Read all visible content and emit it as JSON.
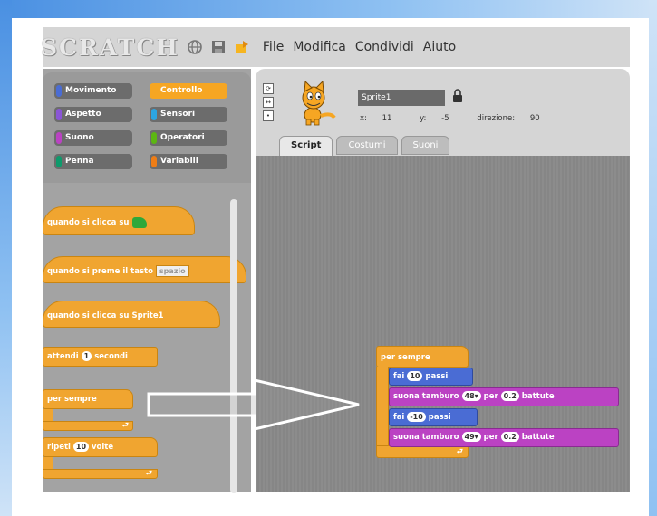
{
  "menubar": {
    "logo": "SCRATCH",
    "menus": [
      "File",
      "Modifica",
      "Condividi",
      "Aiuto"
    ]
  },
  "categories": [
    {
      "label": "Movimento",
      "color": "#4a6cd4"
    },
    {
      "label": "Controllo",
      "color": "#f6a623",
      "active": true
    },
    {
      "label": "Aspetto",
      "color": "#8a55d7"
    },
    {
      "label": "Sensori",
      "color": "#2ca5e2"
    },
    {
      "label": "Suono",
      "color": "#bb42c3"
    },
    {
      "label": "Operatori",
      "color": "#5cb712"
    },
    {
      "label": "Penna",
      "color": "#0e9a6c"
    },
    {
      "label": "Variabili",
      "color": "#ee7d16"
    }
  ],
  "palette_blocks": {
    "when_flag": "quando si clicca su",
    "when_key": "quando si preme il tasto",
    "when_key_value": "spazio",
    "when_sprite": "quando si clicca su Sprite1",
    "wait": "attendi",
    "wait_value": "1",
    "wait_unit": "secondi",
    "forever": "per sempre",
    "repeat": "ripeti",
    "repeat_value": "10",
    "repeat_unit": "volte"
  },
  "sprite": {
    "name": "Sprite1",
    "x_label": "x:",
    "x": "11",
    "y_label": "y:",
    "y": "-5",
    "dir_label": "direzione:",
    "dir": "90"
  },
  "tabs": [
    "Script",
    "Costumi",
    "Suoni"
  ],
  "script": {
    "forever": "per sempre",
    "move1_label": "fai",
    "move1_value": "10",
    "move1_unit": "passi",
    "drum1_label": "suona tamburo",
    "drum1_value": "48▾",
    "drum1_for": "per",
    "drum1_beats": "0.2",
    "drum1_unit": "battute",
    "move2_label": "fai",
    "move2_value": "-10",
    "move2_unit": "passi",
    "drum2_label": "suona tamburo",
    "drum2_value": "49▾",
    "drum2_for": "per",
    "drum2_beats": "0.2",
    "drum2_unit": "battute"
  }
}
